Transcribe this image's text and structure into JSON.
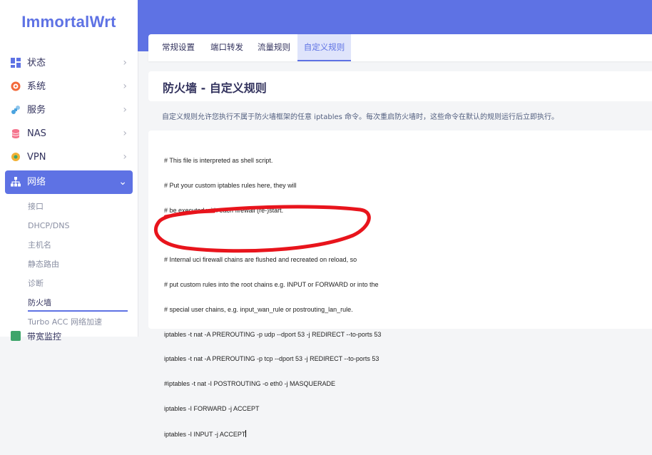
{
  "app": {
    "logo": "ImmortalWrt"
  },
  "sidebar": {
    "items": [
      {
        "label": "状态",
        "icon": "dashboard-icon",
        "color": "#5e72e4"
      },
      {
        "label": "系统",
        "icon": "gear-icon",
        "color": "#f3693a"
      },
      {
        "label": "服务",
        "icon": "puzzle-icon",
        "color": "#4aa3df"
      },
      {
        "label": "NAS",
        "icon": "database-icon",
        "color": "#f5758e"
      },
      {
        "label": "VPN",
        "icon": "shield-icon",
        "color": "#f2b134"
      },
      {
        "label": "网络",
        "icon": "network-icon",
        "color": "#ffffff",
        "active": true
      }
    ],
    "network_sub": [
      {
        "label": "接口"
      },
      {
        "label": "DHCP/DNS"
      },
      {
        "label": "主机名"
      },
      {
        "label": "静态路由"
      },
      {
        "label": "诊断"
      },
      {
        "label": "防火墙",
        "current": true
      },
      {
        "label": "Turbo ACC 网络加速"
      }
    ],
    "bottom_item": "带宽监控"
  },
  "tabs": [
    {
      "label": "常规设置"
    },
    {
      "label": "端口转发"
    },
    {
      "label": "流量规则"
    },
    {
      "label": "自定义规则",
      "active": true
    }
  ],
  "page": {
    "title": "防火墙 - 自定义规则",
    "description": "自定义规则允许您执行不属于防火墙框架的任意 iptables 命令。每次重启防火墙时，这些命令在默认的规则运行后立即执行。"
  },
  "editor": {
    "lines": [
      "# This file is interpreted as shell script.",
      "# Put your custom iptables rules here, they will",
      "# be executed with each firewall (re-)start.",
      "",
      "# Internal uci firewall chains are flushed and recreated on reload, so",
      "# put custom rules into the root chains e.g. INPUT or FORWARD or into the",
      "# special user chains, e.g. input_wan_rule or postrouting_lan_rule.",
      "iptables -t nat -A PREROUTING -p udp --dport 53 -j REDIRECT --to-ports 53",
      "iptables -t nat -A PREROUTING -p tcp --dport 53 -j REDIRECT --to-ports 53",
      "#iptables -t nat -I POSTROUTING -o eth0 -j MASQUERADE",
      "iptables -I FORWARD -j ACCEPT",
      "iptables -I INPUT -j ACCEPT"
    ]
  },
  "colors": {
    "accent": "#5e72e4",
    "annotation": "#e8141c"
  }
}
